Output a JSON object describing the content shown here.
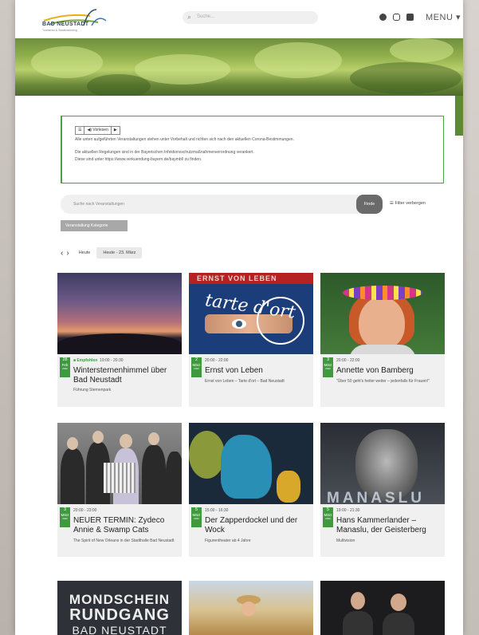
{
  "header": {
    "logo_text": "BAD NEUSTADT",
    "logo_sub": "Tourismus & Stadtmarketing",
    "search_placeholder": "Suche...",
    "menu_label": "MENU ▾"
  },
  "notice": {
    "read_button": "Vorlesen",
    "line1": "Alle unten aufgeführten Veranstaltungen stehen unter Vorbehalt und richten sich nach den aktuellen Corona-Bestimmungen.",
    "line2": "Die aktuellen Regelungen sind in der Bayerischen Infektionsschutzmaßnahmenverordnung verankert.",
    "line3": "Diese sind unter https://www.verkuendung-bayern.de/baymbl/ zu finden."
  },
  "event_search": {
    "placeholder": "Suche nach Veranstaltungen",
    "find_button": "Finde",
    "filter_toggle": "Filter verbergen",
    "category_button": "Veranstaltung Kategorie"
  },
  "date_nav": {
    "today": "Heute",
    "current": "Heute - 23. März"
  },
  "events": [
    {
      "day": "28",
      "month": "Feb",
      "year": "2022",
      "recommended": "Empfohlen",
      "time": "19:00 - 20:30",
      "title": "Wintersternenhimmel über Bad Neustadt",
      "subtitle": "Führung Sternenpark"
    },
    {
      "day": "2",
      "month": "März",
      "year": "2022",
      "recommended": "",
      "time": "20:00 - 22:00",
      "title": "Ernst von Leben",
      "subtitle": "Ernst von Leben – Tarte d'ort – Bad Neustadt"
    },
    {
      "day": "3",
      "month": "März",
      "year": "2022",
      "recommended": "",
      "time": "20:00 - 22:00",
      "title": "Annette von Bamberg",
      "subtitle": "\"Über 50 geht's heiter weiter – jedenfalls für Frauen!\""
    },
    {
      "day": "3",
      "month": "März",
      "year": "2022",
      "recommended": "",
      "time": "20:00 - 23:00",
      "title": "NEUER TERMIN: Zydeco Annie & Swamp Cats",
      "subtitle": "The Spirit of New Orleans in der Stadthalle Bad Neustadt"
    },
    {
      "day": "5",
      "month": "März",
      "year": "2022",
      "recommended": "",
      "time": "15:00 - 16:30",
      "title": "Der Zapperdockel und der Wock",
      "subtitle": "Figurentheater ab 4 Jahre"
    },
    {
      "day": "5",
      "month": "März",
      "year": "2022",
      "recommended": "",
      "time": "19:00 - 21:30",
      "title": "Hans Kammerlander – Manaslu, der Geisterberg",
      "subtitle": "Multivision"
    }
  ],
  "image_text": {
    "tarte_banner": "ERNST VON LEBEN",
    "tarte_word": "tarte d'ort",
    "manaslu": "MANASLU",
    "mond1": "MONDSCHEIN",
    "mond2": "RUNDGANG",
    "mond3": "BAD NEUSTADT"
  }
}
